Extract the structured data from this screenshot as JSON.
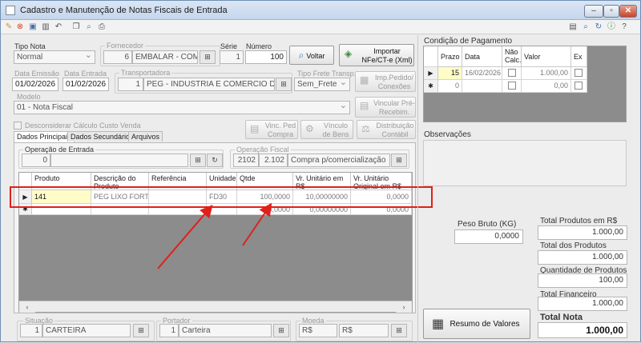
{
  "window": {
    "title": "Cadastro e Manutenção de Notas Fiscais de Entrada"
  },
  "header": {
    "tipo_nota": {
      "label": "Tipo Nota",
      "value": "Normal"
    },
    "fornecedor": {
      "label": "Fornecedor",
      "code": "6",
      "name": "EMBALAR - COM"
    },
    "serie": {
      "label": "Série",
      "value": "1"
    },
    "numero": {
      "label": "Número",
      "value": "100"
    },
    "voltar_label": "Voltar",
    "importar_label": "Importar NFe/CT-e (Xml)",
    "data_emissao": {
      "label": "Data Emissão",
      "value": "01/02/2026"
    },
    "data_entrada": {
      "label": "Data Entrada",
      "value": "01/02/2026"
    },
    "transportadora": {
      "label": "Transportadora",
      "code": "1",
      "name": "PEG - INDUSTRIA E COMERCIO DE"
    },
    "tipo_frete": {
      "label": "Tipo Frete Transp.",
      "value": "Sem_Frete"
    },
    "imp_pedido_label": "Imp.Pedido/ Conexões",
    "modelo": {
      "label": "Modelo",
      "value": "01 - Nota Fiscal"
    },
    "vincular_label": "Vincular Pré-Recebim.",
    "desconsiderar_label": "Desconsiderar Cálculo Custo Venda",
    "vinc_ped_label": "Vinc. Ped Compra",
    "vinculo_bens_label": "Vínculo de Bens",
    "distribuicao_label": "Distribuição Contábil"
  },
  "tabs": [
    "Dados Principais",
    "Dados Secundários",
    "Arquivos"
  ],
  "operacao_entrada": {
    "label": "Operação de Entrada",
    "value": "0"
  },
  "operacao_fiscal": {
    "label": "Operação Fiscal",
    "cfop1": "2102",
    "cfop2": "2.102",
    "desc": "Compra p/comercialização"
  },
  "items_grid": {
    "columns": [
      "Produto",
      "Descrição do Produto",
      "Referência",
      "Unidade",
      "Qtde",
      "Vr. Unitário em R$",
      "Vr. Unitário Original em R$"
    ],
    "rows": [
      {
        "produto": "141",
        "descricao": "PEG LIXO FORT...",
        "referencia": "",
        "unidade": "FD30",
        "qtde": "100,0000",
        "vr_unit": "10,00000000",
        "vr_orig": "0,0000"
      },
      {
        "produto": "",
        "descricao": "",
        "referencia": "",
        "unidade": "",
        "qtde": "0,0000",
        "vr_unit": "0,00000000",
        "vr_orig": "0,0000"
      }
    ]
  },
  "footer": {
    "situacao": {
      "label": "Situação",
      "code": "1",
      "name": "CARTEIRA"
    },
    "portador": {
      "label": "Portador",
      "code": "1",
      "name": "Carteira"
    },
    "moeda": {
      "label": "Moeda",
      "code": "R$",
      "name": "R$"
    }
  },
  "pagamento": {
    "title": "Condição de Pagamento",
    "columns": [
      "Prazo",
      "Data",
      "Não Calc.",
      "Valor",
      "Ex"
    ],
    "rows": [
      {
        "prazo": "15",
        "data": "16/02/2026",
        "valor": "1.000,00"
      },
      {
        "prazo": "0",
        "data": "",
        "valor": "0,00"
      }
    ]
  },
  "observacoes": {
    "label": "Observações"
  },
  "totais": {
    "peso_bruto": {
      "label": "Peso Bruto (KG)",
      "value": "0,0000"
    },
    "total_produtos_rs": {
      "label": "Total Produtos em R$",
      "value": "1.000,00"
    },
    "total_dos_produtos": {
      "label": "Total dos Produtos",
      "value": "1.000,00"
    },
    "quantidade_produtos": {
      "label": "Quantidade de Produtos",
      "value": "100,00"
    },
    "total_financeiro": {
      "label": "Total Financeiro",
      "value": "1.000,00"
    },
    "total_nota": {
      "label": "Total Nota",
      "value": "1.000,00"
    },
    "resumo_label": "Resumo de Valores"
  },
  "accent": {
    "highlight": "#e0201b",
    "selected_cell": "#fffcc8"
  }
}
